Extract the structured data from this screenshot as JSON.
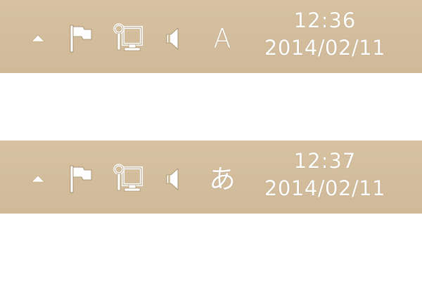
{
  "colors": {
    "tray_background": "#d2bd9c",
    "tray_text": "#ffffff",
    "page_background": "#ffffff"
  },
  "trays": [
    {
      "icons": [
        "chevron-up-icon",
        "flag-icon",
        "network-icon",
        "volume-icon"
      ],
      "ime_indicator": "A",
      "clock": {
        "time": "12:36",
        "date": "2014/02/11"
      }
    },
    {
      "icons": [
        "chevron-up-icon",
        "flag-icon",
        "network-icon",
        "volume-icon"
      ],
      "ime_indicator": "あ",
      "clock": {
        "time": "12:37",
        "date": "2014/02/11"
      }
    }
  ]
}
